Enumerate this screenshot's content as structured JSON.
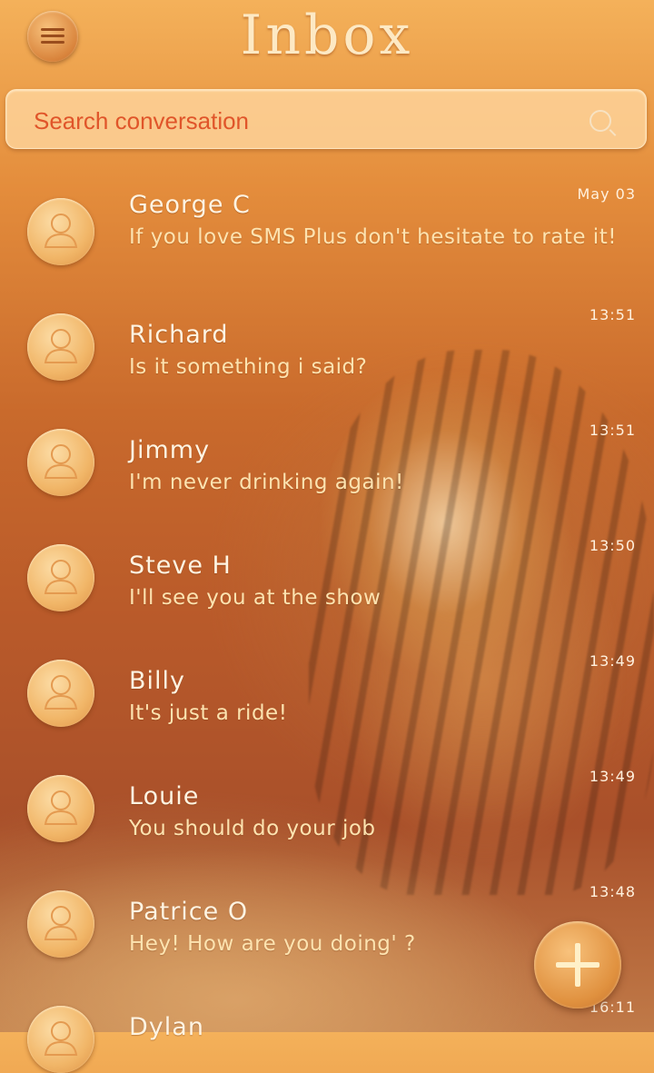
{
  "header": {
    "title": "Inbox",
    "menu_icon": "hamburger-menu-icon"
  },
  "search": {
    "placeholder": "Search conversation",
    "icon": "search-icon"
  },
  "conversations": [
    {
      "name": "George C",
      "message": "If you love SMS Plus don't hesitate to rate it!",
      "time": "May 03"
    },
    {
      "name": "Richard",
      "message": "Is it something i said?",
      "time": "13:51"
    },
    {
      "name": "Jimmy",
      "message": "I'm never drinking again!",
      "time": "13:51"
    },
    {
      "name": "Steve H",
      "message": "I'll see you at the show",
      "time": "13:50"
    },
    {
      "name": "Billy",
      "message": "It's just a ride!",
      "time": "13:49"
    },
    {
      "name": "Louie",
      "message": "You should do your job",
      "time": "13:49"
    },
    {
      "name": "Patrice O",
      "message": "Hey! How are you doing' ?",
      "time": "13:48"
    },
    {
      "name": "Dylan",
      "message": "",
      "time": "16:11"
    }
  ],
  "fab": {
    "icon": "plus-icon"
  },
  "colors": {
    "accent": "#e0552a",
    "text_light": "#fff4e2",
    "message_text": "#fde3b0"
  }
}
